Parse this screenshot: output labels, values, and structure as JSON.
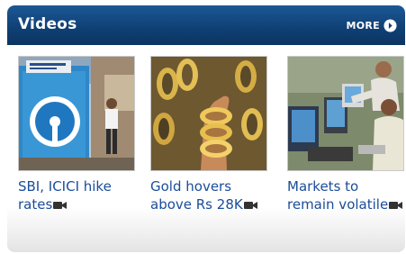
{
  "widget": {
    "title": "Videos",
    "more_label": "MORE",
    "colors": {
      "header": "#0f3f73",
      "link": "#1a4d99"
    }
  },
  "videos": [
    {
      "title_line1": "SBI, ICICI hike",
      "title_line2": "rates",
      "thumbnail": "sbi-bank-thumbnail",
      "badge_icon": "video-camera-icon"
    },
    {
      "title_line1": "Gold hovers",
      "title_line2": "above Rs 28K",
      "thumbnail": "gold-bangles-thumbnail",
      "badge_icon": "video-camera-icon"
    },
    {
      "title_line1": "Markets to",
      "title_line2": "remain volatile",
      "thumbnail": "stock-traders-thumbnail",
      "badge_icon": "video-camera-icon"
    }
  ]
}
